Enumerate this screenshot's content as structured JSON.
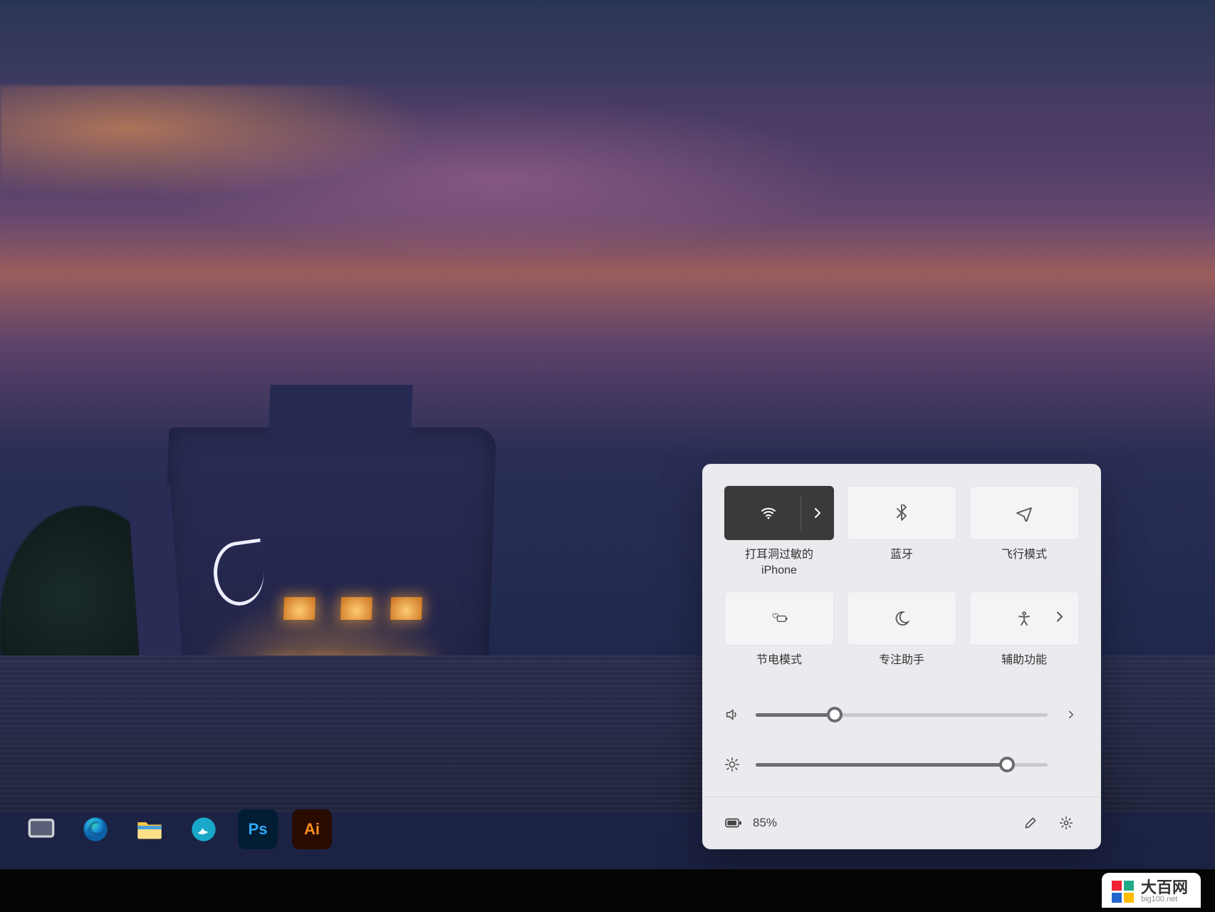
{
  "taskbar": {
    "items": [
      {
        "name": "task-view",
        "color": "#9ea2a8"
      },
      {
        "name": "edge",
        "color": "#2aa0d8"
      },
      {
        "name": "file-explorer",
        "color": "#f8c545"
      },
      {
        "name": "app-round",
        "color": "#1aa8c9"
      },
      {
        "name": "photoshop",
        "label": "Ps",
        "bg": "#001d34",
        "fg": "#2fa6ff"
      },
      {
        "name": "illustrator",
        "label": "Ai",
        "bg": "#2a0b00",
        "fg": "#ff8f1c"
      }
    ]
  },
  "quick_settings": {
    "tiles": [
      {
        "id": "wifi",
        "label": "打耳洞过敏的\niPhone",
        "active": true,
        "icon": "wifi",
        "chevron": true
      },
      {
        "id": "bluetooth",
        "label": "蓝牙",
        "active": false,
        "icon": "bluetooth",
        "chevron": false
      },
      {
        "id": "airplane",
        "label": "飞行模式",
        "active": false,
        "icon": "airplane",
        "chevron": false
      },
      {
        "id": "battery-saver",
        "label": "节电模式",
        "active": false,
        "icon": "leaf-battery",
        "chevron": false
      },
      {
        "id": "focus-assist",
        "label": "专注助手",
        "active": false,
        "icon": "moon",
        "chevron": false
      },
      {
        "id": "accessibility",
        "label": "辅助功能",
        "active": false,
        "icon": "person",
        "chevron": true
      }
    ],
    "volume": {
      "percent": 27
    },
    "brightness": {
      "percent": 86
    },
    "battery_text": "85%"
  },
  "watermark": {
    "title": "大百网",
    "sub": "big100.net"
  }
}
